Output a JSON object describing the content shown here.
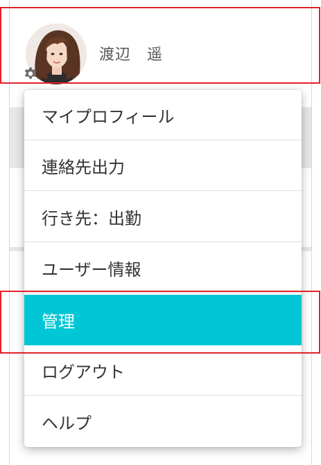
{
  "user": {
    "name": "渡辺　遥"
  },
  "menu": {
    "items": [
      {
        "label": "マイプロフィール"
      },
      {
        "label": "連絡先出力"
      },
      {
        "label": "行き先：出勤"
      },
      {
        "label": "ユーザー情報"
      },
      {
        "label": "管理",
        "active": true
      },
      {
        "label": "ログアウト"
      },
      {
        "label": "ヘルプ"
      }
    ]
  },
  "colors": {
    "active_item_bg": "#00c6d5",
    "highlight_border": "#e3202b",
    "text": "#333333"
  },
  "icons": {
    "settings": "gear-icon"
  }
}
